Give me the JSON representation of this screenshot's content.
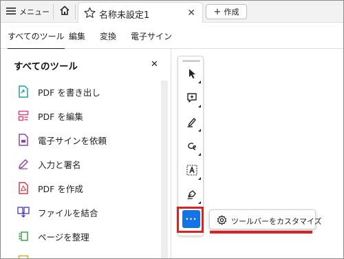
{
  "tabbar": {
    "menu_label": "メニュー",
    "doc_tab_title": "名称未設定1",
    "create_label": "作成"
  },
  "menu": {
    "items": [
      "すべてのツール",
      "編集",
      "変換",
      "電子サイン"
    ],
    "active_index": 0
  },
  "panel": {
    "title": "すべてのツール",
    "tools": [
      {
        "label": "PDF を書き出し",
        "icon": "export-pdf-icon",
        "color": "#20a39e"
      },
      {
        "label": "PDF を編集",
        "icon": "edit-pdf-icon",
        "color": "#e0457b"
      },
      {
        "label": "電子サインを依頼",
        "icon": "request-esign-icon",
        "color": "#8e44ad"
      },
      {
        "label": "入力と署名",
        "icon": "fill-sign-icon",
        "color": "#8e44ad"
      },
      {
        "label": "PDF を作成",
        "icon": "create-pdf-icon",
        "color": "#e0384e"
      },
      {
        "label": "ファイルを結合",
        "icon": "combine-files-icon",
        "color": "#5b3fc4"
      },
      {
        "label": "ページを整理",
        "icon": "organize-pages-icon",
        "color": "#2e9e3a"
      }
    ]
  },
  "toolbar": {
    "tools": [
      "select-cursor-icon",
      "add-comment-icon",
      "highlight-pen-icon",
      "draw-freehand-icon",
      "text-select-icon",
      "fill-sign-pen-icon"
    ],
    "more_label": "···"
  },
  "popup": {
    "label": "ツールバーをカスタマイズ"
  },
  "colors": {
    "accent": "#1473e6",
    "highlight": "#e02020"
  }
}
